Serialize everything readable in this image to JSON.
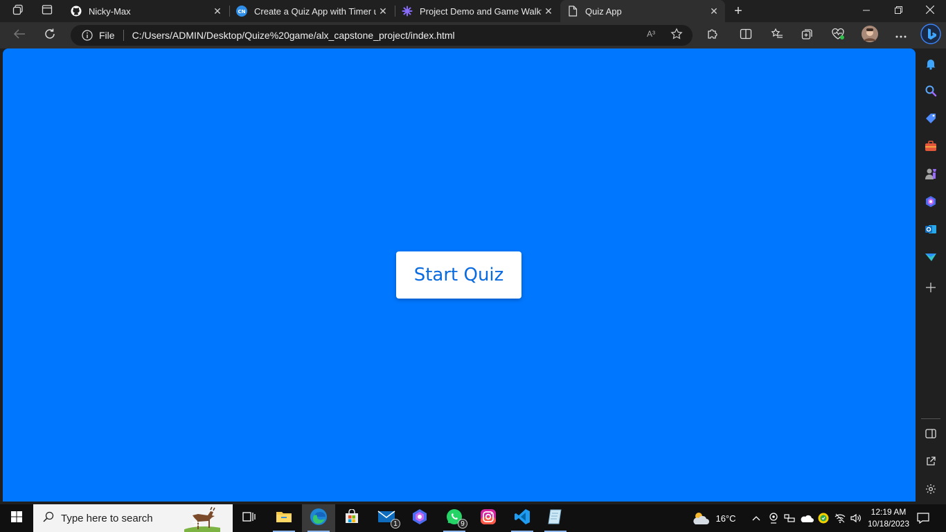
{
  "tabs": [
    {
      "title": "Nicky-Max",
      "favicon": "github-icon"
    },
    {
      "title": "Create a Quiz App with Timer usi",
      "favicon": "codingnepal-icon"
    },
    {
      "title": "Project Demo and Game Walkthr",
      "favicon": "alx-icon"
    },
    {
      "title": "Quiz App",
      "favicon": "page-icon",
      "active": true
    }
  ],
  "address": {
    "scheme_label": "File",
    "url": "C:/Users/ADMIN/Desktop/Quize%20game/alx_capstone_project/index.html",
    "read_aloud": "A³"
  },
  "page": {
    "start_button_label": "Start Quiz",
    "background": "#0077ff",
    "button_text_color": "#0a6be0"
  },
  "taskbar": {
    "search_placeholder": "Type here to search",
    "mail_badge": "1",
    "whatsapp_badge": "9"
  },
  "tray": {
    "temperature": "16°C",
    "time": "12:19 AM",
    "date": "10/18/2023"
  }
}
